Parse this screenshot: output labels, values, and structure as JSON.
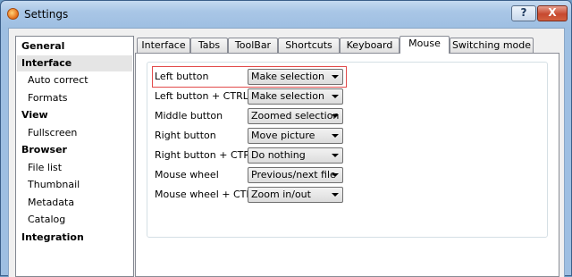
{
  "window": {
    "title": "Settings",
    "help_label": "?",
    "close_label": "X"
  },
  "sidebar": {
    "items": [
      {
        "label": "General",
        "type": "category"
      },
      {
        "label": "Interface",
        "type": "category",
        "selected": true
      },
      {
        "label": "Auto correct",
        "type": "item"
      },
      {
        "label": "Formats",
        "type": "item"
      },
      {
        "label": "View",
        "type": "category"
      },
      {
        "label": "Fullscreen",
        "type": "item"
      },
      {
        "label": "Browser",
        "type": "category"
      },
      {
        "label": "File list",
        "type": "item"
      },
      {
        "label": "Thumbnail",
        "type": "item"
      },
      {
        "label": "Metadata",
        "type": "item"
      },
      {
        "label": "Catalog",
        "type": "item"
      },
      {
        "label": "Integration",
        "type": "category"
      }
    ]
  },
  "tabs": [
    {
      "label": "Interface"
    },
    {
      "label": "Tabs"
    },
    {
      "label": "ToolBar"
    },
    {
      "label": "Shortcuts"
    },
    {
      "label": "Keyboard"
    },
    {
      "label": "Mouse",
      "active": true
    },
    {
      "label": "Switching mode"
    }
  ],
  "mouse_settings": [
    {
      "label": "Left button",
      "value": "Make selection",
      "highlighted": true
    },
    {
      "label": "Left button + CTRL",
      "value": "Make selection"
    },
    {
      "label": "Middle button",
      "value": "Zoomed selection"
    },
    {
      "label": "Right button",
      "value": "Move picture"
    },
    {
      "label": "Right button + CTRL",
      "value": "Do nothing"
    },
    {
      "label": "Mouse wheel",
      "value": "Previous/next file"
    },
    {
      "label": "Mouse wheel + CTRL",
      "value": "Zoom in/out"
    }
  ]
}
